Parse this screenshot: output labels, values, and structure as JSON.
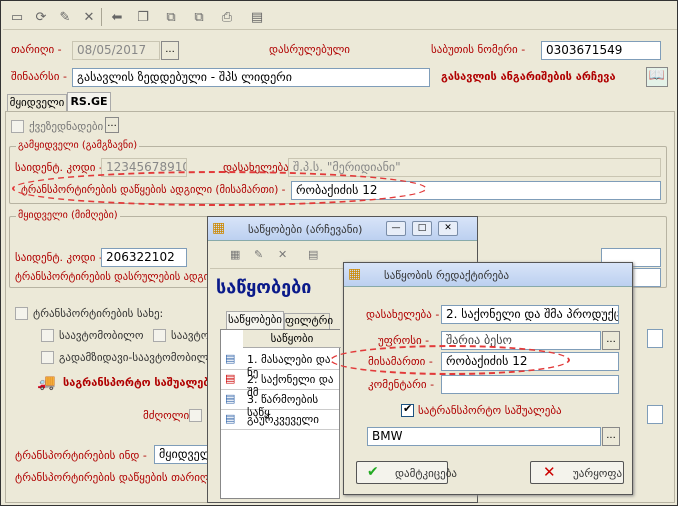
{
  "header": {
    "date_label": "თარიღი -",
    "date_value": "08/05/2017",
    "status": "დასრულებული",
    "account_label": "საბუთის ნომერი -",
    "account_value": "0303671549"
  },
  "bill": {
    "label": "შინაარსი -",
    "value": "გასავლის ზედდებული - შპს ლიდერი",
    "report_link": "გასავლის ანგარიშების არჩევა"
  },
  "tabs": [
    "მყიდველი",
    "RS.GE"
  ],
  "excise_label": "ქვეზედნადები",
  "seller": {
    "title": "გამყიდველი (გამგზავნი)",
    "id_label": "საიდენტ. კოდი -",
    "id_value": "12345678910",
    "name_label": "დასახელება -",
    "name_value": "შ.პ.ს. \"მერიდიანი\"",
    "addr_label": "ტრანსპორტირების დაწყების ადგილი (მისამართი) -",
    "addr_value": "რობაქიძის 12"
  },
  "buyer": {
    "title": "მყიდველი (მიმღები)",
    "id_label": "საიდენტ. კოდი -",
    "id_value": "206322102",
    "addr_label": "ტრანსპორტირების დასრულების ადგილი"
  },
  "transport": {
    "check_label": "ტრანსპორტირების სახე:",
    "opts": [
      "საავტომობილო",
      "საავტო",
      "გადამზიდავი-საავტომობილო"
    ],
    "means": "საგრანსპორტო საშუალების",
    "driver_label": "მძღოლი -",
    "start_label": "ტრანსპორტირების ინდ -",
    "start_value": "მყიდველი",
    "begin_label": "ტრანსპორტირების დაწყების თარიღი -"
  },
  "win1": {
    "title": "საწყობები (არჩევანი)",
    "heading": "საწყობები",
    "tabs": [
      "საწყობები",
      "ფილტრი"
    ],
    "col": "საწყობი",
    "rows": [
      "1. მასალები და ნე",
      "2. საქონელი და შმ",
      "3. წარმოების საწყ",
      "გაურკვეველი"
    ]
  },
  "win2": {
    "title": "საწყობის რედაქტირება",
    "name_label": "დასახელება -",
    "name_value": "2. საქონელი და შმა პროდუქცია",
    "resp_label": "უფროსი -",
    "resp_value": "შარია ბესო",
    "addr_label": "მისამართი -",
    "addr_value": "რობაქიძის 12",
    "comment_label": "კომენტარი -",
    "transport_label": "სატრანსპორტო საშუალება",
    "car_value": "BMW",
    "ok": "დამტკიცება",
    "cancel": "უარყოფა"
  }
}
